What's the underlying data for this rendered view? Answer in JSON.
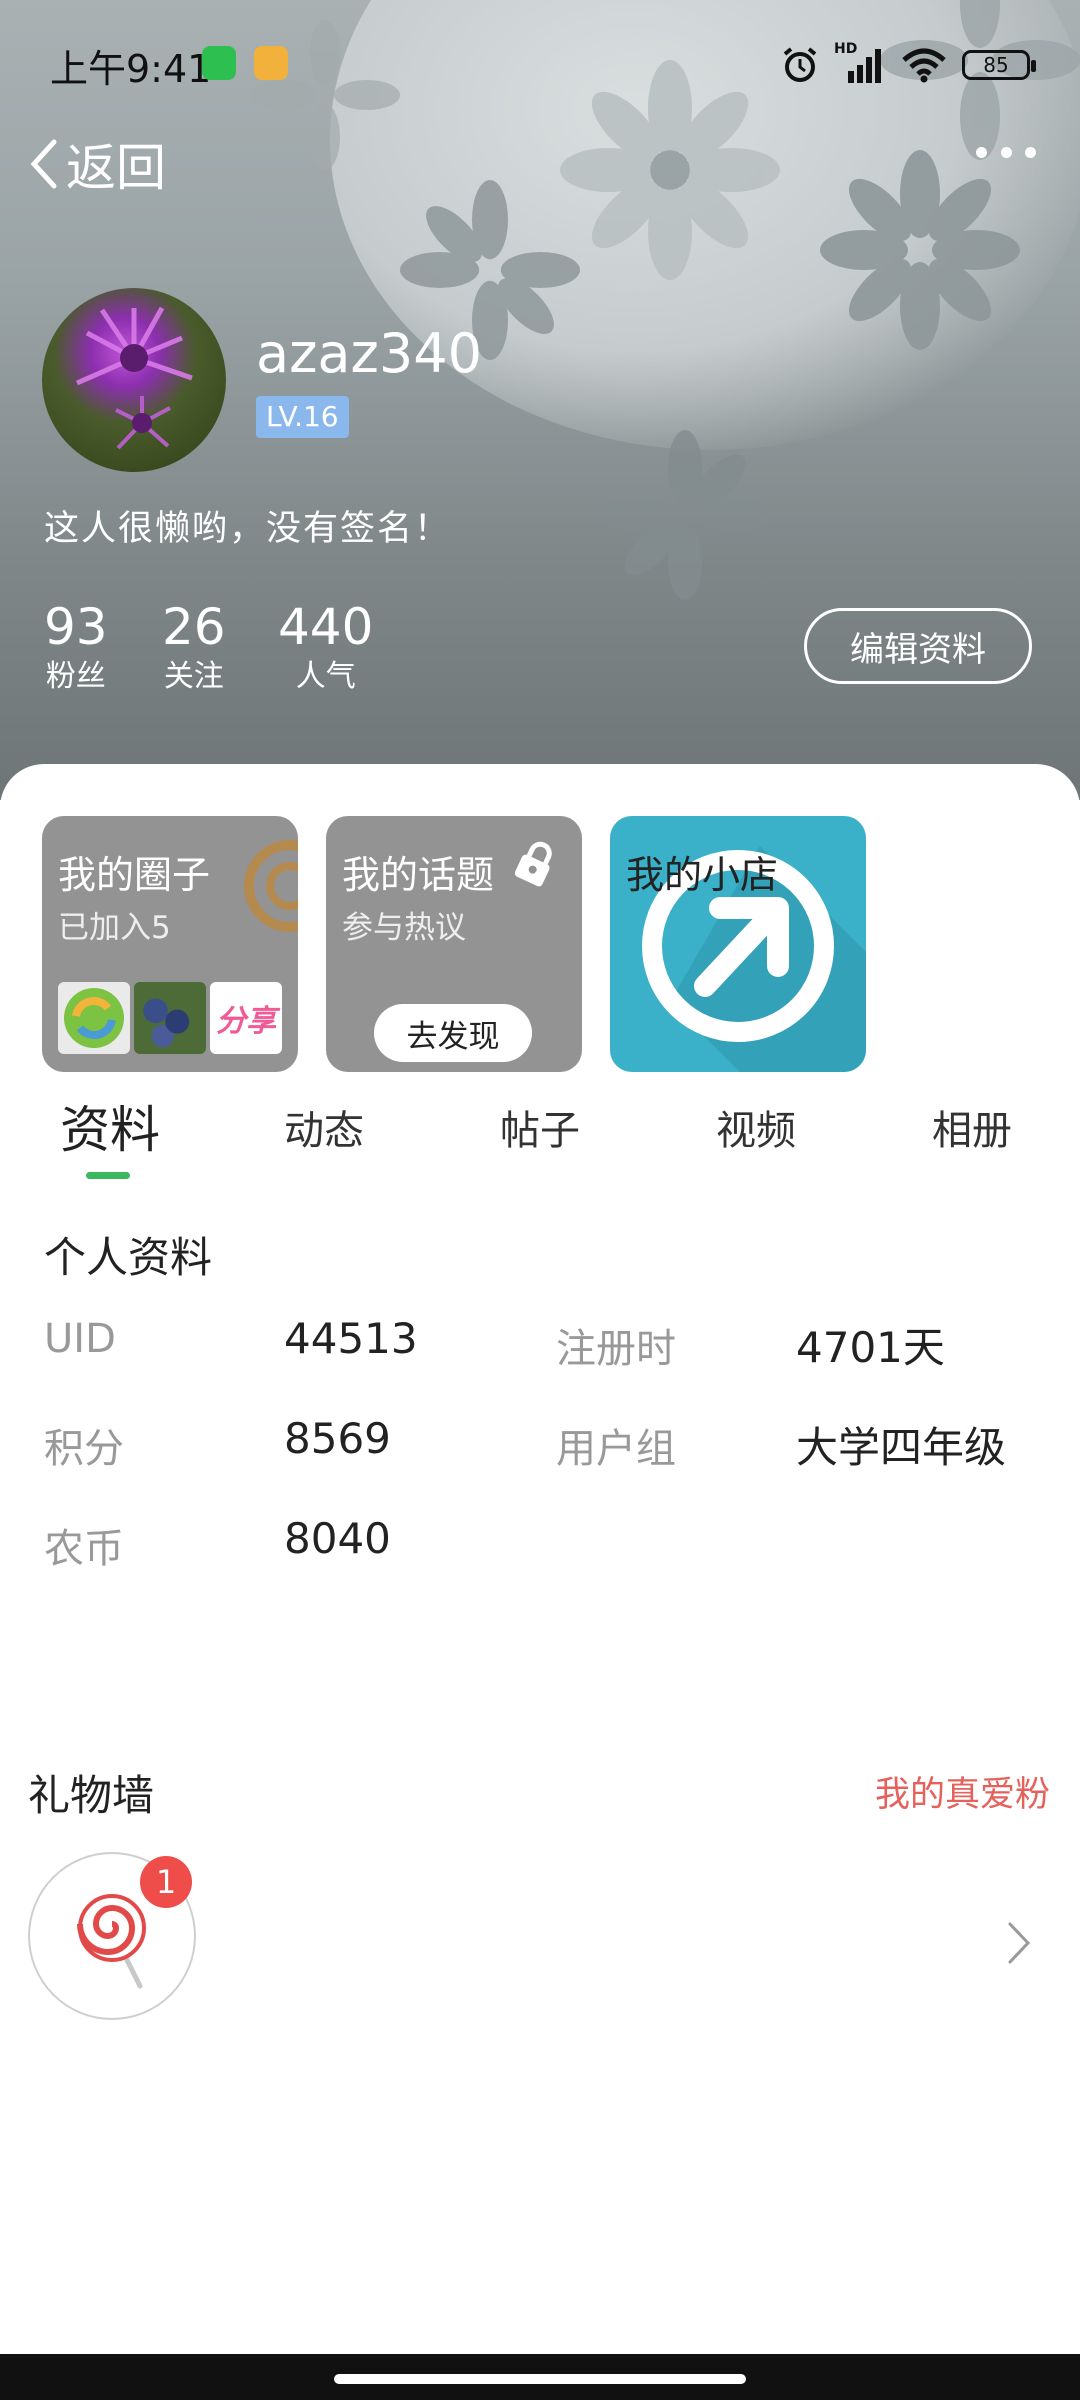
{
  "status_bar": {
    "time": "上午9:41",
    "apps": [
      "wechat-icon",
      "files-icon"
    ],
    "signal_label": "HD",
    "battery": "85"
  },
  "header": {
    "back_label": "返回",
    "username": "azaz340",
    "level": "LV.16",
    "signature": "这人很懒哟，没有签名！",
    "stats": [
      {
        "value": "93",
        "label": "粉丝"
      },
      {
        "value": "26",
        "label": "关注"
      },
      {
        "value": "440",
        "label": "人气"
      }
    ],
    "edit_label": "编辑资料"
  },
  "cards": {
    "circle": {
      "title": "我的圈子",
      "sub": "已加入5",
      "share_thumb": "分享"
    },
    "topic": {
      "title": "我的话题",
      "sub": "参与热议",
      "button": "去发现"
    },
    "shop": {
      "title": "我的小店"
    }
  },
  "tabs": [
    "资料",
    "动态",
    "帖子",
    "视频",
    "相册"
  ],
  "profile": {
    "title": "个人资料",
    "rows": [
      {
        "label": "UID",
        "value": "44513"
      },
      {
        "label": "注册时",
        "value": "4701天"
      },
      {
        "label": "积分",
        "value": "8569"
      },
      {
        "label": "用户组",
        "value": "大学四年级"
      },
      {
        "label": "农币",
        "value": "8040"
      }
    ]
  },
  "gifts": {
    "title": "礼物墙",
    "link": "我的真爱粉",
    "badge": "1"
  },
  "colors": {
    "accent_green": "#3bb75e",
    "level_badge": "#8bb8ec",
    "link_red": "#e5625c",
    "shop_teal": "#3ab0c9"
  }
}
